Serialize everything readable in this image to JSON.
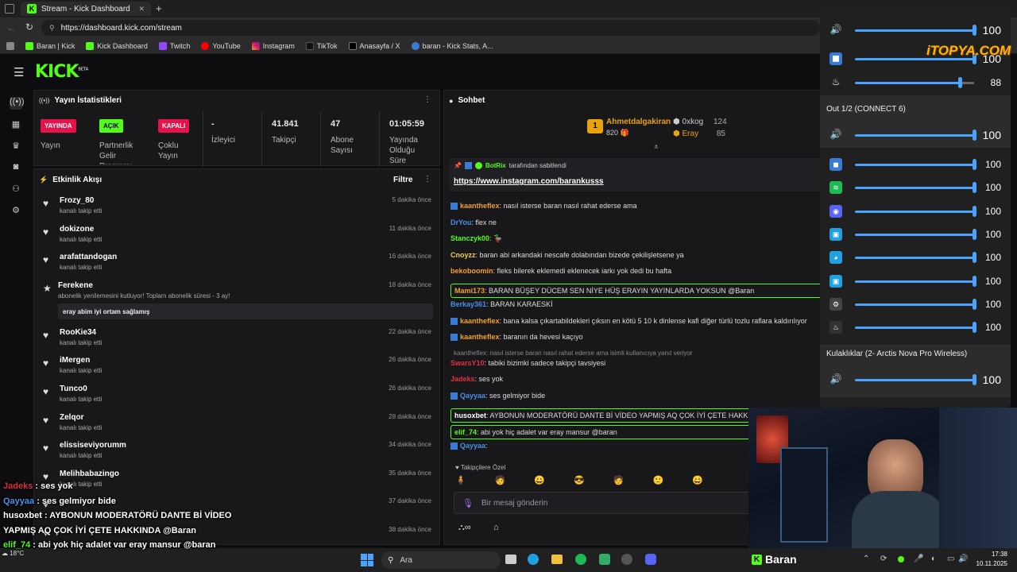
{
  "browser": {
    "tab_title": "Stream - Kick Dashboard",
    "tab_close": "✕",
    "new_tab": "+",
    "url": "https://dashboard.kick.com/stream",
    "bookmarks": [
      "Baran | Kick",
      "Kick Dashboard",
      "Twitch",
      "YouTube",
      "Instagram",
      "TikTok",
      "Anasayfa / X",
      "baran - Kick Stats, A..."
    ]
  },
  "kick": {
    "logo": "KICK",
    "beta": "BETA",
    "stats_title": "Yayın İstatistikleri",
    "stats": [
      {
        "badge": "YAYINDA",
        "label": "Yayın"
      },
      {
        "badge": "AÇIK",
        "label": "Partnerlik Gelir Programı"
      },
      {
        "badge": "KAPALI",
        "label": "Çoklu Yayın"
      },
      {
        "value": "-",
        "label": "İzleyici"
      },
      {
        "value": "41.841",
        "label": "Takipçi"
      },
      {
        "value": "47",
        "label": "Abone Sayısı"
      },
      {
        "value": "01:05:59",
        "label": "Yayında Olduğu Süre"
      }
    ],
    "activity_title": "Etkinlik Akışı",
    "filter_label": "Filtre",
    "activity": [
      {
        "name": "Frozy_80",
        "sub": "kanalı takip etti",
        "time": "5 dakika önce"
      },
      {
        "name": "dokizone",
        "sub": "kanalı takip etti",
        "time": "11 dakika önce"
      },
      {
        "name": "arafattandogan",
        "sub": "kanalı takip etti",
        "time": "16 dakika önce"
      },
      {
        "name": "Ferekene",
        "sub": "abonelik yenilemesini kutluyor! Toplam abonelik süresi - 3 ay!",
        "time": "18 dakika önce",
        "message": "eray abim iyi ortam sağlamış"
      },
      {
        "name": "RooKie34",
        "sub": "kanalı takip etti",
        "time": "22 dakika önce"
      },
      {
        "name": "iMergen",
        "sub": "kanalı takip etti",
        "time": "26 dakika önce"
      },
      {
        "name": "Tunco0",
        "sub": "kanalı takip etti",
        "time": "26 dakika önce"
      },
      {
        "name": "Zelqor",
        "sub": "kanalı takip etti",
        "time": "28 dakika önce"
      },
      {
        "name": "elissiseviyorumm",
        "sub": "kanalı takip etti",
        "time": "34 dakika önce"
      },
      {
        "name": "Melihbabazingo",
        "sub": "kanalı takip etti",
        "time": "35 dakika önce"
      },
      {
        "name": "",
        "sub": "",
        "time": "37 dakika önce"
      },
      {
        "name": "",
        "sub": "",
        "time": "38 dakika önce"
      }
    ],
    "chat_title": "Sohbet",
    "top_gifters": [
      {
        "name": "Ahmetdalgakiran",
        "value": "820"
      },
      {
        "name": "0xkog",
        "value": "124"
      },
      {
        "name": "Eray",
        "value": "85"
      }
    ],
    "pinned_by": "BotRix",
    "pinned_suffix": "tarafından sabitlendi",
    "pinned_link": "https://www.instagram.com/barankusss",
    "chat": [
      {
        "user": "kaantheflex",
        "color": "#f0a030",
        "text": "nasıl isterse baran nasıl rahat ederse ama"
      },
      {
        "user": "DrYou",
        "color": "#4a8fe8",
        "text": "flex ne"
      },
      {
        "user": "Stanczyk00",
        "color": "#53fc18",
        "text": "🦆"
      },
      {
        "user": "Cnoyzz",
        "color": "#f0d040",
        "text": "baran abi arkandaki nescafe dolabından bizede çekilişletsene ya"
      },
      {
        "user": "bekoboomin",
        "color": "#f0a030",
        "text": "fleks bilerek eklemedi eklenecek iarkı yok dedi bu hafta"
      },
      {
        "user": "Mami173",
        "color": "#f0a030",
        "text": "BARAN BÜŞEY DÜCEM SEN NİYE HÜŞ ERAYIN YAYINLARDA YOKSUN @Baran"
      },
      {
        "user": "Berkay361",
        "color": "#4a8fe8",
        "text": "BARAN KARAESKİ"
      },
      {
        "user": "kaantheflex",
        "color": "#f0a030",
        "text": "bana kalsa çıkartabildekleri çıksın en kötü 5 10 k dinlense kafi diğer türlü tozlu raflara kaldırılıyor"
      },
      {
        "user": "kaantheflex",
        "color": "#f0a030",
        "text": "baranın da hevesi kaçıyo"
      },
      {
        "reply": "kaantheflex: nasıl isterse baran nasıl rahat ederse ama isimli kullanıcıya yanıt veriyor"
      },
      {
        "user": "SwarsY10",
        "color": "#e03040",
        "text": "tabiki bizimki sadece takipçi tavsiyesi"
      },
      {
        "user": "Jadeks",
        "color": "#e03040",
        "text": "ses yok"
      },
      {
        "user": "Qayyaa",
        "color": "#4a8fe8",
        "text": "ses gelmiyor bide"
      },
      {
        "user": "husoxbet",
        "color": "#ffffff",
        "text": "AYBONUN MODERATÖRÜ DANTE Bİ VİDEO YAPMIŞ AQ ÇOK İYİ ÇETE HAKKINDA"
      },
      {
        "user": "elif_74",
        "color": "#53fc18",
        "text": "abi yok hiç adalet var eray mansur @baran"
      },
      {
        "user": "Qayyaa",
        "color": "#4a8fe8",
        "text": ""
      }
    ],
    "followers_only": "Takipçilere Özel",
    "chat_placeholder": "Bir mesaj gönderin"
  },
  "mixer": {
    "top_values": [
      "100",
      "100",
      "88"
    ],
    "section1": "Out 1/2 (CONNECT 6)",
    "section1_main": "100",
    "section1_apps": [
      "100",
      "100",
      "100",
      "100",
      "100",
      "100",
      "100",
      "100"
    ],
    "section2": "Kulaklıklar (2- Arctis Nova Pro Wireless)",
    "section2_main": "100"
  },
  "watermark": "iTOPYA.COM",
  "overlay": {
    "lines": [
      {
        "user": "Jadeks",
        "text": " : ses yok"
      },
      {
        "user": "Qayyaa",
        "text": " : ses gelmiyor bide"
      },
      {
        "user": "husoxbet",
        "text": " : AYBONUN MODERATÖRÜ DANTE Bİ VİDEO"
      },
      {
        "user": "",
        "text": "YAPMIŞ AQ ÇOK İYİ ÇETE HAKKINDA @Baran"
      },
      {
        "user": "elif_74",
        "text": " : abi yok hiç adalet var eray mansur @baran"
      }
    ],
    "brand": "Baran"
  },
  "taskbar": {
    "search": "Ara",
    "temp": "18°C",
    "time": "17:38",
    "date": "10.11.2025"
  }
}
